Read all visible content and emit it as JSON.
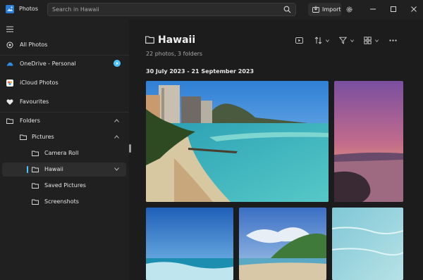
{
  "app": {
    "title": "Photos"
  },
  "search": {
    "placeholder": "Search in Hawaii"
  },
  "header": {
    "import_label": "Import"
  },
  "sidebar": {
    "items": [
      {
        "label": "All Photos",
        "icon": "photos-icon"
      },
      {
        "label": "OneDrive - Personal",
        "icon": "onedrive-icon"
      },
      {
        "label": "iCloud Photos",
        "icon": "icloud-icon"
      },
      {
        "label": "Favourites",
        "icon": "heart-icon"
      },
      {
        "label": "Folders",
        "icon": "folder-icon"
      },
      {
        "label": "Pictures",
        "icon": "folder-icon"
      },
      {
        "label": "Camera Roll",
        "icon": "folder-icon"
      },
      {
        "label": "Hawaii",
        "icon": "folder-icon",
        "selected": true
      },
      {
        "label": "Saved Pictures",
        "icon": "folder-icon"
      },
      {
        "label": "Screenshots",
        "icon": "folder-icon"
      }
    ]
  },
  "main": {
    "folder_title": "Hawaii",
    "subtitle": "22 photos, 3 folders",
    "date_range": "30 July 2023 - 21 September 2023"
  },
  "colors": {
    "accent": "#4cc2ff",
    "background": "#1c1c1c",
    "sidebar": "#202020"
  }
}
